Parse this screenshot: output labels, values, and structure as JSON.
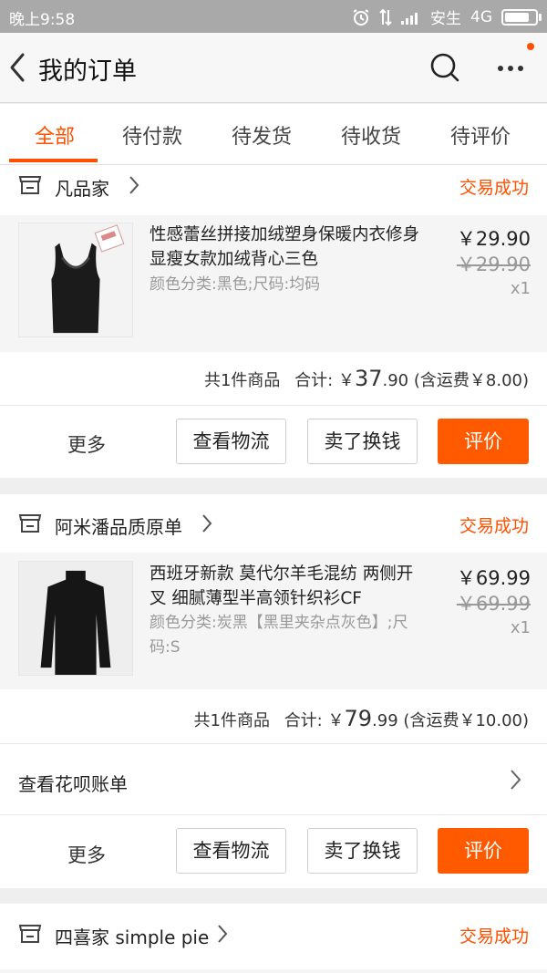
{
  "status_bar": {
    "time": "晚上9:58",
    "carrier": "安生",
    "network": "4G",
    "battery_level": 0.85
  },
  "header": {
    "title": "我的订单"
  },
  "tabs": [
    {
      "label": "全部",
      "active": true
    },
    {
      "label": "待付款",
      "active": false
    },
    {
      "label": "待发货",
      "active": false
    },
    {
      "label": "待收货",
      "active": false
    },
    {
      "label": "待评价",
      "active": false
    }
  ],
  "orders": [
    {
      "shop": "凡品家",
      "status": "交易成功",
      "item": {
        "name": "性感蕾丝拼接加绒塑身保暖内衣修身显瘦女款加绒背心三色",
        "spec": "颜色分类:黑色;尺码:均码",
        "price": "￥29.90",
        "original_price": "￥29.90",
        "qty": "x1"
      },
      "summary": {
        "count": "共1件商品",
        "label": "合计:",
        "currency": "￥",
        "int": "37",
        "dec": ".90",
        "shipping": "(含运费￥8.00)"
      },
      "actions": {
        "more": "更多",
        "logistics": "查看物流",
        "resell": "卖了换钱",
        "review": "评价"
      }
    },
    {
      "shop": "阿米潘品质原单",
      "status": "交易成功",
      "item": {
        "name": "西班牙新款 莫代尔羊毛混纺 两侧开叉 细腻薄型半高领针织衫CF",
        "spec": "颜色分类:炭黑【黑里夹杂点灰色】;尺码:S",
        "price": "￥69.99",
        "original_price": "￥69.99",
        "qty": "x1"
      },
      "summary": {
        "count": "共1件商品",
        "label": "合计:",
        "currency": "￥",
        "int": "79",
        "dec": ".99",
        "shipping": "(含运费￥10.00)"
      },
      "huabei": "查看花呗账单",
      "actions": {
        "more": "更多",
        "logistics": "查看物流",
        "resell": "卖了换钱",
        "review": "评价"
      }
    },
    {
      "shop": "四喜家 simple pie",
      "status": "交易成功"
    }
  ],
  "colors": {
    "accent": "#ff5000",
    "button": "#ff5a00",
    "muted": "#999999"
  }
}
